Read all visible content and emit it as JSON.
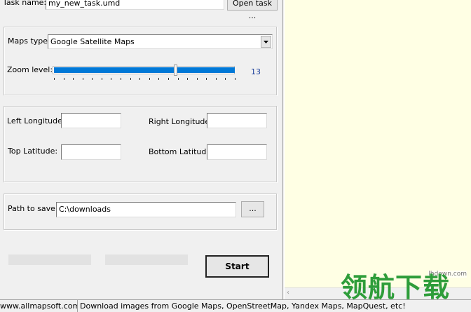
{
  "task": {
    "label": "Task name:",
    "value": "my_new_task.umd",
    "open_button": "Open task ..."
  },
  "maps": {
    "type_label": "Maps type:",
    "type_value": "Google Satellite Maps",
    "zoom_label": "Zoom level:",
    "zoom_value": "13",
    "zoom_level": 13,
    "zoom_max": 19
  },
  "coords": {
    "left_lon_label": "Left Longitude:",
    "right_lon_label": "Right Longitude:",
    "top_lat_label": "Top Latitude:",
    "bottom_lat_label": "Bottom Latitude:",
    "left_lon": "",
    "right_lon": "",
    "top_lat": "",
    "bottom_lat": ""
  },
  "save": {
    "label": "Path to save:",
    "value": "C:\\downloads",
    "browse_button": "..."
  },
  "actions": {
    "start_button": "Start"
  },
  "status": {
    "website": "www.allmapsoft.com",
    "message": "Download images from Google Maps, OpenStreetMap, Yandex Maps, MapQuest, etc!"
  },
  "watermark": {
    "text": "领航下载",
    "url": "lhdown.com"
  },
  "colors": {
    "slider_fill": "#0078d7",
    "map_panel_bg": "#ffffe4",
    "zoom_value_color": "#1a3e9a",
    "watermark_green": "#2e9d3a"
  }
}
